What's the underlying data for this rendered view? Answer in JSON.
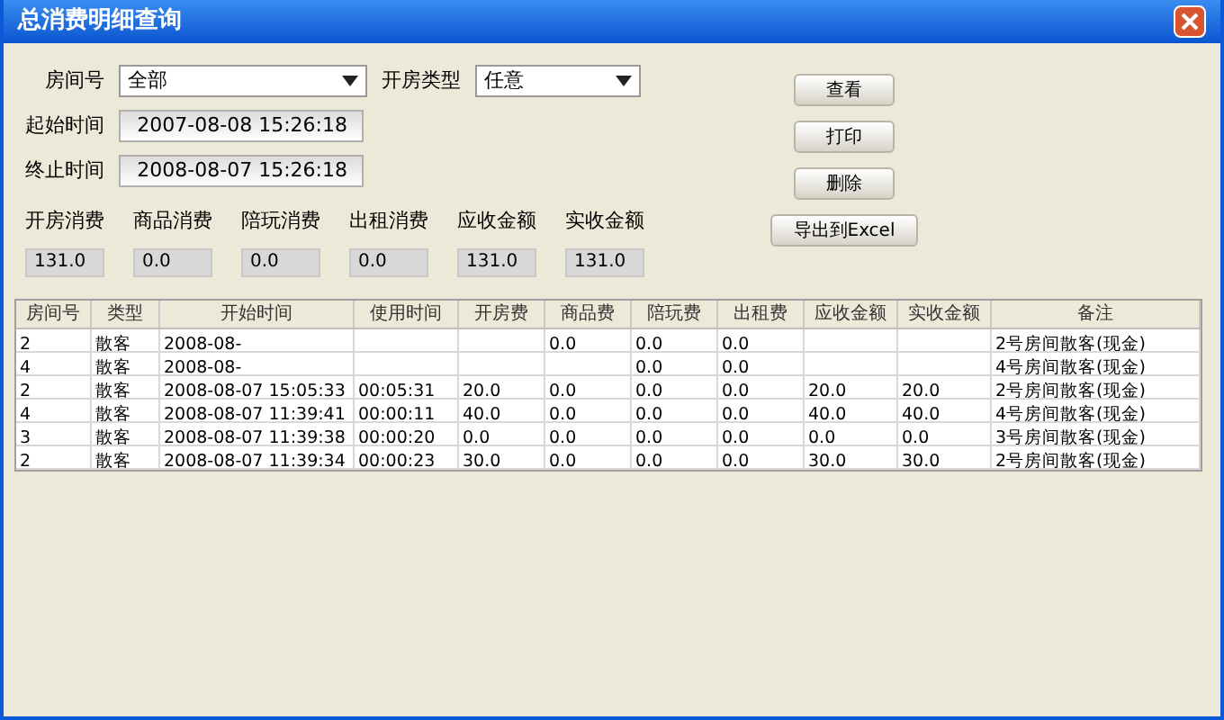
{
  "window": {
    "title": "总消费明细查询"
  },
  "filters": {
    "room_label": "房间号",
    "room_value": "全部",
    "type_label": "开房类型",
    "type_value": "任意",
    "start_label": "起始时间",
    "start_value": "2007-08-08 15:26:18",
    "end_label": "终止时间",
    "end_value": "2008-08-07 15:26:18"
  },
  "totals": [
    {
      "label": "开房消费",
      "value": "131.0"
    },
    {
      "label": "商品消费",
      "value": "0.0"
    },
    {
      "label": "陪玩消费",
      "value": "0.0"
    },
    {
      "label": "出租消费",
      "value": "0.0"
    },
    {
      "label": "应收金额",
      "value": "131.0"
    },
    {
      "label": "实收金额",
      "value": "131.0"
    }
  ],
  "buttons": [
    "查看",
    "打印",
    "删除",
    "导出到Excel"
  ],
  "table": {
    "columns": [
      "房间号",
      "类型",
      "开始时间",
      "使用时间",
      "开房费",
      "商品费",
      "陪玩费",
      "出租费",
      "应收金额",
      "实收金额",
      "备注"
    ],
    "rows": [
      [
        "2",
        "散客",
        "2008-08-",
        null,
        null,
        "0.0",
        "0.0",
        "0.0",
        null,
        null,
        "2号房间散客(现金)"
      ],
      [
        "4",
        "散客",
        "2008-08-",
        null,
        null,
        null,
        "0.0",
        "0.0",
        null,
        null,
        "4号房间散客(现金)"
      ],
      [
        "2",
        "散客",
        "2008-08-07 15:05:33",
        "00:05:31",
        "20.0",
        "0.0",
        "0.0",
        "0.0",
        "20.0",
        "20.0",
        "2号房间散客(现金)"
      ],
      [
        "4",
        "散客",
        "2008-08-07 11:39:41",
        "00:00:11",
        "40.0",
        "0.0",
        "0.0",
        "0.0",
        "40.0",
        "40.0",
        "4号房间散客(现金)"
      ],
      [
        "3",
        "散客",
        "2008-08-07 11:39:38",
        "00:00:20",
        "0.0",
        "0.0",
        "0.0",
        "0.0",
        "0.0",
        "0.0",
        "3号房间散客(现金)"
      ],
      [
        "2",
        "散客",
        "2008-08-07 11:39:34",
        "00:00:23",
        "30.0",
        "0.0",
        "0.0",
        "0.0",
        "30.0",
        "30.0",
        "2号房间散客(现金)"
      ]
    ]
  }
}
